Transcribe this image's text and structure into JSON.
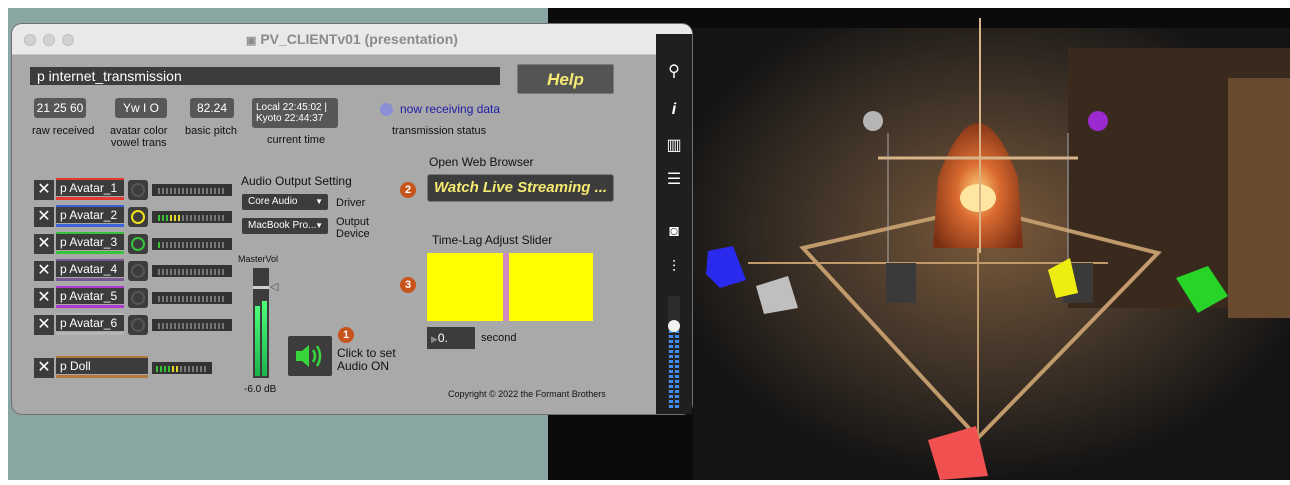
{
  "window": {
    "title": "PV_CLIENTv01 (presentation)"
  },
  "transmission": {
    "patcher_label": "p internet_transmission",
    "help_label": "Help",
    "raw_value": "21 25 60",
    "raw_label": "raw received",
    "avatar_color_value": "Yw I O",
    "avatar_color_label": "avatar color\nvowel trans",
    "pitch_value": "82.24",
    "pitch_label": "basic pitch",
    "time_local": "Local 22:45:02 |",
    "time_kyoto": "Kyoto 22:44:37",
    "time_label": "current time",
    "status_text": "now receiving data",
    "status_label": "transmission status"
  },
  "avatars": [
    {
      "name": "p Avatar_1",
      "color": "#e23a2e",
      "ring_color": "#555555"
    },
    {
      "name": "p Avatar_2",
      "color": "#3c63d8",
      "ring_color": "#f2e21b"
    },
    {
      "name": "p Avatar_3",
      "color": "#36c23a",
      "ring_color": "#36c23a"
    },
    {
      "name": "p Avatar_4",
      "color": "#7a5a95",
      "ring_color": "#555555"
    },
    {
      "name": "p Avatar_5",
      "color": "#b03ad0",
      "ring_color": "#555555"
    },
    {
      "name": "p Avatar_6",
      "color": "#b5b5b5",
      "ring_color": "#555555"
    }
  ],
  "doll": {
    "name": "p Doll",
    "color": "#b27a3a"
  },
  "audio": {
    "title": "Audio Output Setting",
    "driver_value": "Core Audio",
    "driver_label": "Driver",
    "device_value": "MacBook Pro...",
    "device_label": "Output\nDevice",
    "mastervol_label": "MasterVol",
    "level_text": "-6.0 dB",
    "speaker_step": "1",
    "speaker_text": "Click to set\nAudio ON"
  },
  "browser": {
    "title": "Open Web Browser",
    "step": "2",
    "button_label": "Watch Live Streaming ..."
  },
  "timelag": {
    "title": "Time-Lag Adjust Slider",
    "step": "3",
    "value": "0.",
    "unit": "second"
  },
  "copyright": "Copyright © 2022 the Formant Brothers",
  "sidebar": {
    "icons": [
      "search-icon",
      "info-icon",
      "columns-icon",
      "list-icon",
      "camera-icon",
      "mixer-icon"
    ],
    "volume_level": 0.7
  },
  "colors": {
    "accent_orange": "#c7541a",
    "slider_yellow": "#ffff00",
    "slider_marker": "#d08abf",
    "cube_blue": "#2a2aee",
    "cube_yellow": "#eded11",
    "cube_green": "#27d427",
    "cube_red": "#f05050"
  }
}
